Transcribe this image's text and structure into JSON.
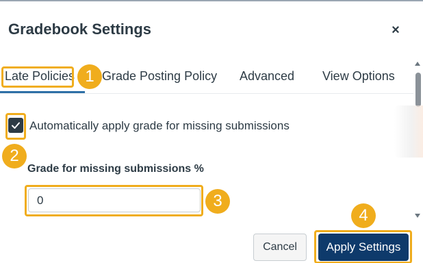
{
  "dialog": {
    "title": "Gradebook Settings",
    "close_symbol": "×"
  },
  "tabs": [
    {
      "label": "Late Policies",
      "selected": true
    },
    {
      "label": "Grade Posting Policy",
      "selected": false
    },
    {
      "label": "Advanced",
      "selected": false
    },
    {
      "label": "View Options",
      "selected": false
    }
  ],
  "late_policies": {
    "missing_checkbox": {
      "label": "Automatically apply grade for missing submissions",
      "checked": true
    },
    "grade_field": {
      "label": "Grade for missing submissions %",
      "value": "0"
    }
  },
  "footer": {
    "cancel_label": "Cancel",
    "apply_label": "Apply Settings"
  },
  "annotations": [
    "1",
    "2",
    "3",
    "4"
  ],
  "colors": {
    "highlight": "#f0ad1d",
    "primary_button": "#0e3a6b",
    "tab_underline": "#2d6fa6",
    "text": "#2d3b45"
  },
  "icons": {
    "close": "close-icon",
    "checkbox": "checkmark-icon",
    "scroll_up": "scroll-up-arrow-icon",
    "scroll_down": "scroll-down-arrow-icon"
  }
}
